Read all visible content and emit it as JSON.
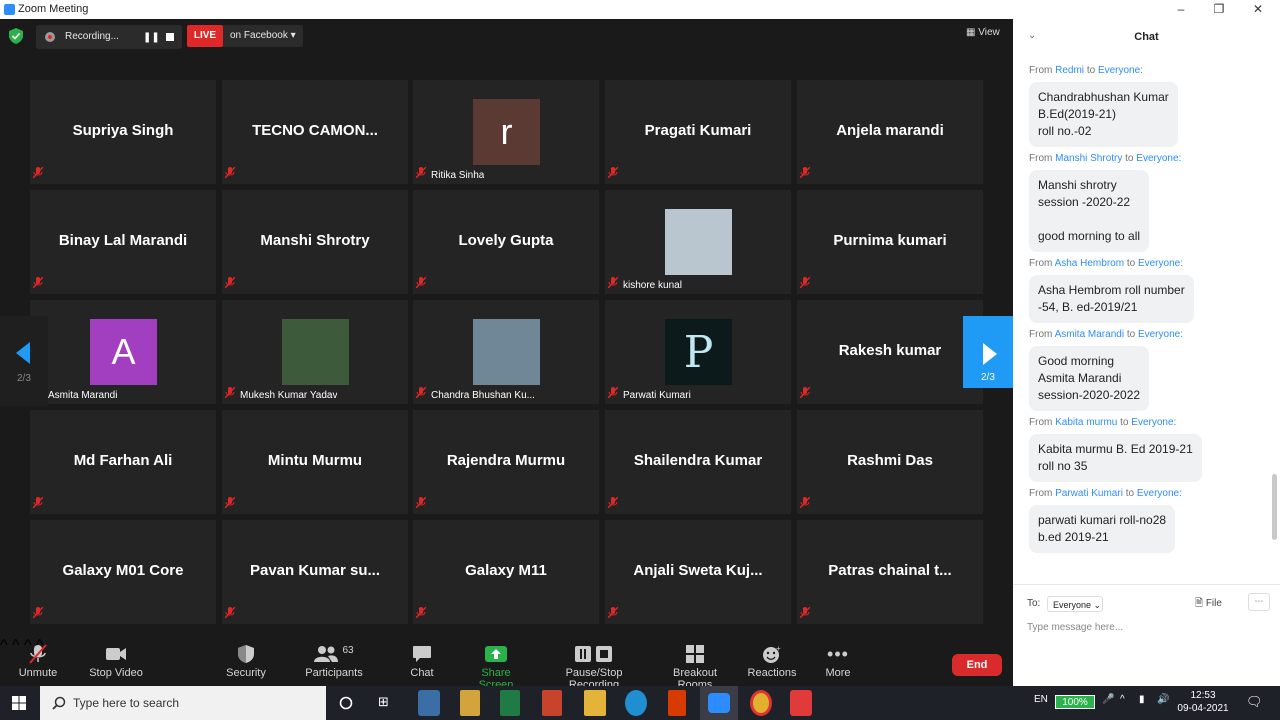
{
  "window": {
    "title": "Zoom Meeting"
  },
  "top": {
    "recording_label": "Recording...",
    "live_label": "LIVE",
    "live_target": "on Facebook",
    "view_label": "View"
  },
  "pager": {
    "left": "2/3",
    "right": "2/3"
  },
  "tiles": [
    {
      "name": "Supriya Singh",
      "caption": ""
    },
    {
      "name": "TECNO  CAMON...",
      "caption": ""
    },
    {
      "name": "",
      "caption": "Ritika Sinha",
      "avatar_letter": "r",
      "avatar_color": "#5a3a33"
    },
    {
      "name": "Pragati Kumari",
      "caption": ""
    },
    {
      "name": "Anjela marandi",
      "caption": ""
    },
    {
      "name": "Binay Lal Marandi",
      "caption": ""
    },
    {
      "name": "Manshi Shrotry",
      "caption": ""
    },
    {
      "name": "Lovely Gupta",
      "caption": ""
    },
    {
      "name": "",
      "caption": "kishore kunal",
      "avatar_color": "#b9c6cf"
    },
    {
      "name": "Purnima kumari",
      "caption": ""
    },
    {
      "name": "",
      "caption": "Asmita Marandi",
      "avatar_letter": "A",
      "avatar_color": "#a23fc1"
    },
    {
      "name": "",
      "caption": "Mukesh Kumar Yadav",
      "avatar_color": "#3d5a3a"
    },
    {
      "name": "",
      "caption": "Chandra Bhushan Ku...",
      "avatar_color": "#6f8796"
    },
    {
      "name": "",
      "caption": "Parwati Kumari",
      "avatar_letter": "P",
      "avatar_color": "#0d1a1c"
    },
    {
      "name": "Rakesh kumar",
      "caption": ""
    },
    {
      "name": "Md Farhan Ali",
      "caption": ""
    },
    {
      "name": "Mintu Murmu",
      "caption": ""
    },
    {
      "name": "Rajendra Murmu",
      "caption": ""
    },
    {
      "name": "Shailendra Kumar",
      "caption": ""
    },
    {
      "name": "Rashmi Das",
      "caption": ""
    },
    {
      "name": "Galaxy M01 Core",
      "caption": ""
    },
    {
      "name": "Pavan Kumar su...",
      "caption": ""
    },
    {
      "name": "Galaxy M11",
      "caption": ""
    },
    {
      "name": "Anjali  Sweta  Kuj...",
      "caption": ""
    },
    {
      "name": "Patras chainal  t...",
      "caption": ""
    }
  ],
  "toolbar": {
    "unmute": "Unmute",
    "stop_video": "Stop Video",
    "security": "Security",
    "participants": "Participants",
    "participants_count": "63",
    "chat": "Chat",
    "share_screen": "Share Screen",
    "recording": "Pause/Stop Recording",
    "breakout": "Breakout Rooms",
    "reactions": "Reactions",
    "more": "More",
    "end": "End"
  },
  "chat": {
    "title": "Chat",
    "from_word": "From",
    "to_word": "to",
    "messages": [
      {
        "sender": "Redmi",
        "recipient": "Everyone:",
        "lines": [
          "Chandrabhushan Kumar",
          "B.Ed(2019-21)",
          "roll no.-02"
        ]
      },
      {
        "sender": "Manshi Shrotry",
        "recipient": "Everyone:",
        "lines": [
          "Manshi shrotry",
          "session -2020-22",
          "",
          "good morning to all"
        ]
      },
      {
        "sender": "Asha Hembrom",
        "recipient": "Everyone:",
        "lines": [
          "Asha Hembrom roll number",
          "-54, B. ed-2019/21"
        ]
      },
      {
        "sender": "Asmita Marandi",
        "recipient": "Everyone:",
        "lines": [
          "Good morning",
          "Asmita Marandi",
          "session-2020-2022"
        ]
      },
      {
        "sender": "Kabita murmu",
        "recipient": "Everyone:",
        "lines": [
          "Kabita murmu B. Ed 2019-21",
          "roll no 35"
        ]
      },
      {
        "sender": "Parwati Kumari",
        "recipient": "Everyone:",
        "lines": [
          "parwati kumari roll-no28",
          "b.ed 2019-21"
        ]
      }
    ],
    "to_label": "To:",
    "to_value": "Everyone",
    "file_label": "File",
    "placeholder": "Type message here..."
  },
  "taskbar": {
    "search_placeholder": "Type here to search",
    "lang": "EN",
    "battery": "100%",
    "time": "12:53",
    "date": "09-04-2021"
  }
}
